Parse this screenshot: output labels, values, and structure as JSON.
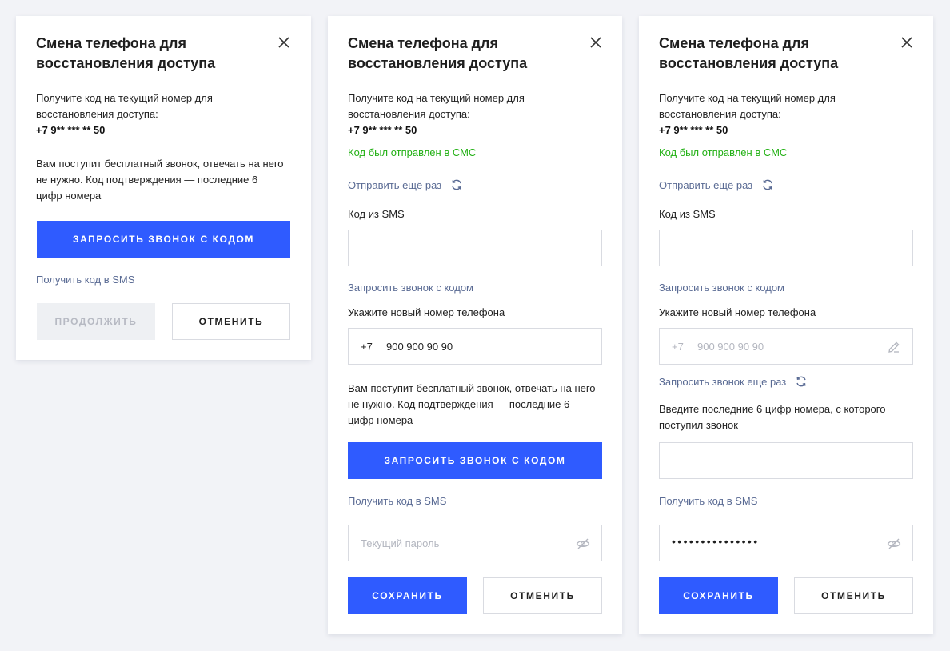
{
  "common": {
    "title": "Смена телефона для восстановления доступа",
    "intro_text": "Получите код на текущий номер для восстановления доступа:",
    "current_phone": "+7 9** *** ** 50",
    "call_info": "Вам поступит бесплатный звонок, отвечать на него не нужно. Код подтверждения — последние 6 цифр номера",
    "request_call_button": "ЗАПРОСИТЬ ЗВОНОК С КОДОМ",
    "sms_link": "Получить код в SMS",
    "cancel_button": "ОТМЕНИТЬ",
    "save_button": "СОХРАНИТЬ"
  },
  "card1": {
    "continue_button": "ПРОДОЛЖИТЬ"
  },
  "card2": {
    "sms_sent_status": "Код был отправлен в СМС",
    "resend_link": "Отправить ещё раз",
    "sms_code_label": "Код из SMS",
    "sms_code_value": "",
    "request_call_link": "Запросить звонок с кодом",
    "new_phone_label": "Укажите новый номер телефона",
    "phone_prefix": "+7",
    "phone_value": "900 900 90 90",
    "password_placeholder": "Текущий пароль"
  },
  "card3": {
    "sms_sent_status": "Код был отправлен в СМС",
    "resend_link": "Отправить ещё раз",
    "sms_code_label": "Код из SMS",
    "request_call_link": "Запросить звонок с кодом",
    "new_phone_label": "Укажите новый номер телефона",
    "phone_prefix": "+7",
    "phone_value": "900 900 90 90",
    "request_again_link": "Запросить звонок еще раз",
    "last_digits_label": "Введите последние 6 цифр номера, с которого поступил звонок",
    "password_masked": "•••••••••••••••"
  },
  "colors": {
    "primary": "#2f5bff",
    "success": "#22b014",
    "link": "#5a6b94",
    "border": "#d9dbe1",
    "background": "#f2f3f7"
  },
  "icons": [
    "close-icon",
    "refresh-icon",
    "pencil-icon",
    "eye-off-icon"
  ]
}
